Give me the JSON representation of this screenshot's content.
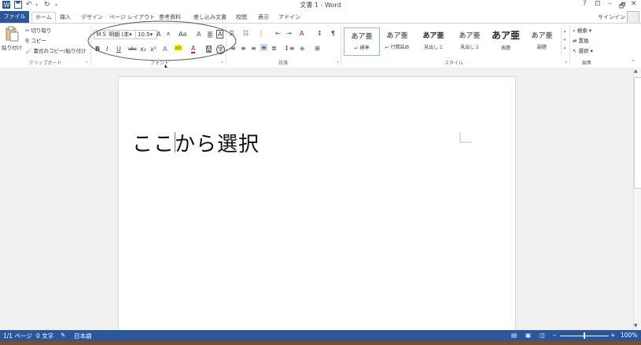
{
  "title_bar": {
    "title": "文書 1 - Word",
    "help": "?",
    "ribbon_options": "⊡",
    "minimize": "–",
    "restore": "🗗",
    "close": "✕"
  },
  "tabs": [
    "ファイル",
    "ホーム",
    "挿入",
    "デザイン",
    "ページ レイアウト",
    "参考資料",
    "差し込み文書",
    "校閲",
    "表示",
    "アドイン"
  ],
  "signin": "サインイン",
  "clipboard": {
    "paste": "貼り付け",
    "cut": "切り取り",
    "copy": "コピー",
    "format_painter": "書式のコピー/貼り付け",
    "label": "クリップボード"
  },
  "font": {
    "name": "ＭＳ 明朝 (本",
    "size": "10.5",
    "label": "フォント",
    "grow": "A",
    "shrink": "A",
    "case": "Aa",
    "clear": "A",
    "phonetic": "亜",
    "border": "A",
    "bold": "B",
    "italic": "I",
    "underline": "U",
    "strike": "abc",
    "sub": "x₂",
    "sup": "x²",
    "effects": "A",
    "highlight": "ab",
    "color": "A",
    "shade": "A",
    "enclose": "字"
  },
  "paragraph": {
    "label": "段落"
  },
  "styles": {
    "label": "スタイル",
    "items": [
      {
        "sample": "あア亜",
        "name": "↵ 標準"
      },
      {
        "sample": "あア亜",
        "name": "↵ 行間詰め"
      },
      {
        "sample": "あア亜",
        "name": "見出し 1"
      },
      {
        "sample": "あア亜",
        "name": "見出し 2"
      },
      {
        "sample": "あア亜",
        "name": "表題"
      },
      {
        "sample": "あア亜",
        "name": "副題"
      }
    ]
  },
  "editing": {
    "label": "編集",
    "find": "検索",
    "replace": "置換",
    "select": "選択"
  },
  "document": {
    "annotation": "ここから選択"
  },
  "status": {
    "page": "1/1 ページ",
    "words": "0 文字",
    "language": "日本語",
    "zoom": "100%",
    "zoom_level": 1.0
  },
  "colors": {
    "accent": "#2b579a",
    "highlight": "#ffff00",
    "font_color": "#ff0000"
  }
}
